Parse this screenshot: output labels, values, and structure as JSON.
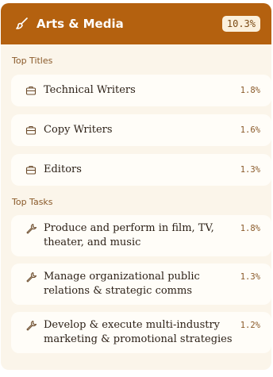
{
  "header": {
    "title": "Arts & Media",
    "percent": "10.3%",
    "icon": "brush-icon",
    "color": "#b4610f"
  },
  "titles_section": {
    "label": "Top Titles",
    "items": [
      {
        "label": "Technical Writers",
        "value": "1.8%",
        "icon": "briefcase-icon"
      },
      {
        "label": "Copy Writers",
        "value": "1.6%",
        "icon": "briefcase-icon"
      },
      {
        "label": "Editors",
        "value": "1.3%",
        "icon": "briefcase-icon"
      }
    ]
  },
  "tasks_section": {
    "label": "Top Tasks",
    "items": [
      {
        "label": "Produce and perform in film, TV, theater, and music",
        "value": "1.8%",
        "icon": "wrench-icon"
      },
      {
        "label": "Manage organizational public relations & strategic comms",
        "value": "1.3%",
        "icon": "wrench-icon"
      },
      {
        "label": "Develop & execute multi-industry marketing & promotional strategies",
        "value": "1.2%",
        "icon": "wrench-icon"
      }
    ]
  }
}
